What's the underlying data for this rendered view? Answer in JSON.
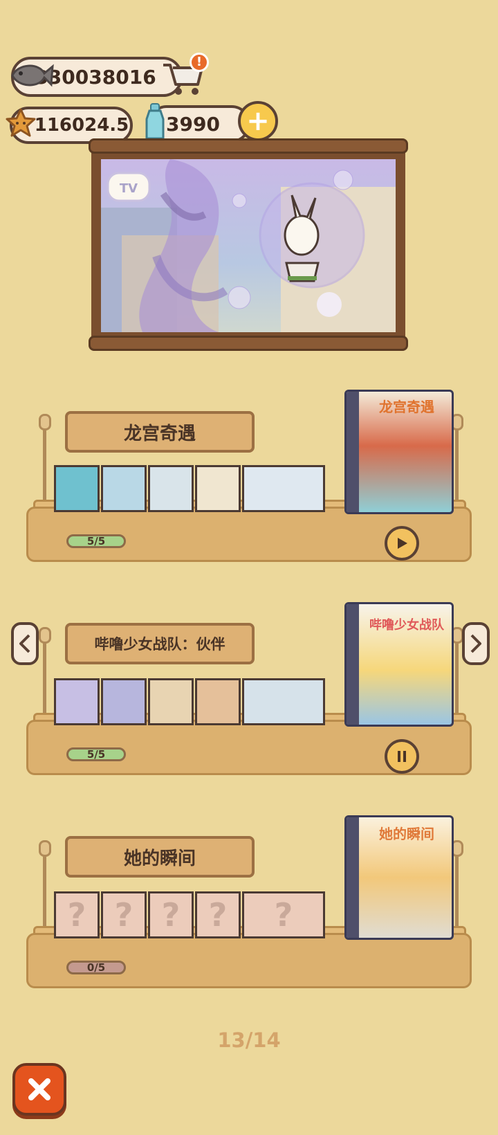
{
  "currency": {
    "fish": "330038016",
    "stars": "116024.5",
    "bottles": "3990"
  },
  "tv": {
    "label": "TV"
  },
  "albums": [
    {
      "title": "龙宫奇遇",
      "progress": "5/5",
      "state": "play",
      "cover_title": "龙宫奇遇"
    },
    {
      "title": "哔噜少女战队：伙伴",
      "progress": "5/5",
      "state": "pause",
      "cover_title": "哔噜少女战队"
    },
    {
      "title": "她的瞬间",
      "progress": "0/5",
      "state": "locked",
      "cover_title": "她的瞬间"
    }
  ],
  "locked_mark": "?",
  "pager": {
    "label": "13/14"
  },
  "colors": {
    "background": "#ecd89b",
    "progress_done": "#a7d28a",
    "progress_none": "#c49a8f",
    "close": "#e4541e"
  }
}
